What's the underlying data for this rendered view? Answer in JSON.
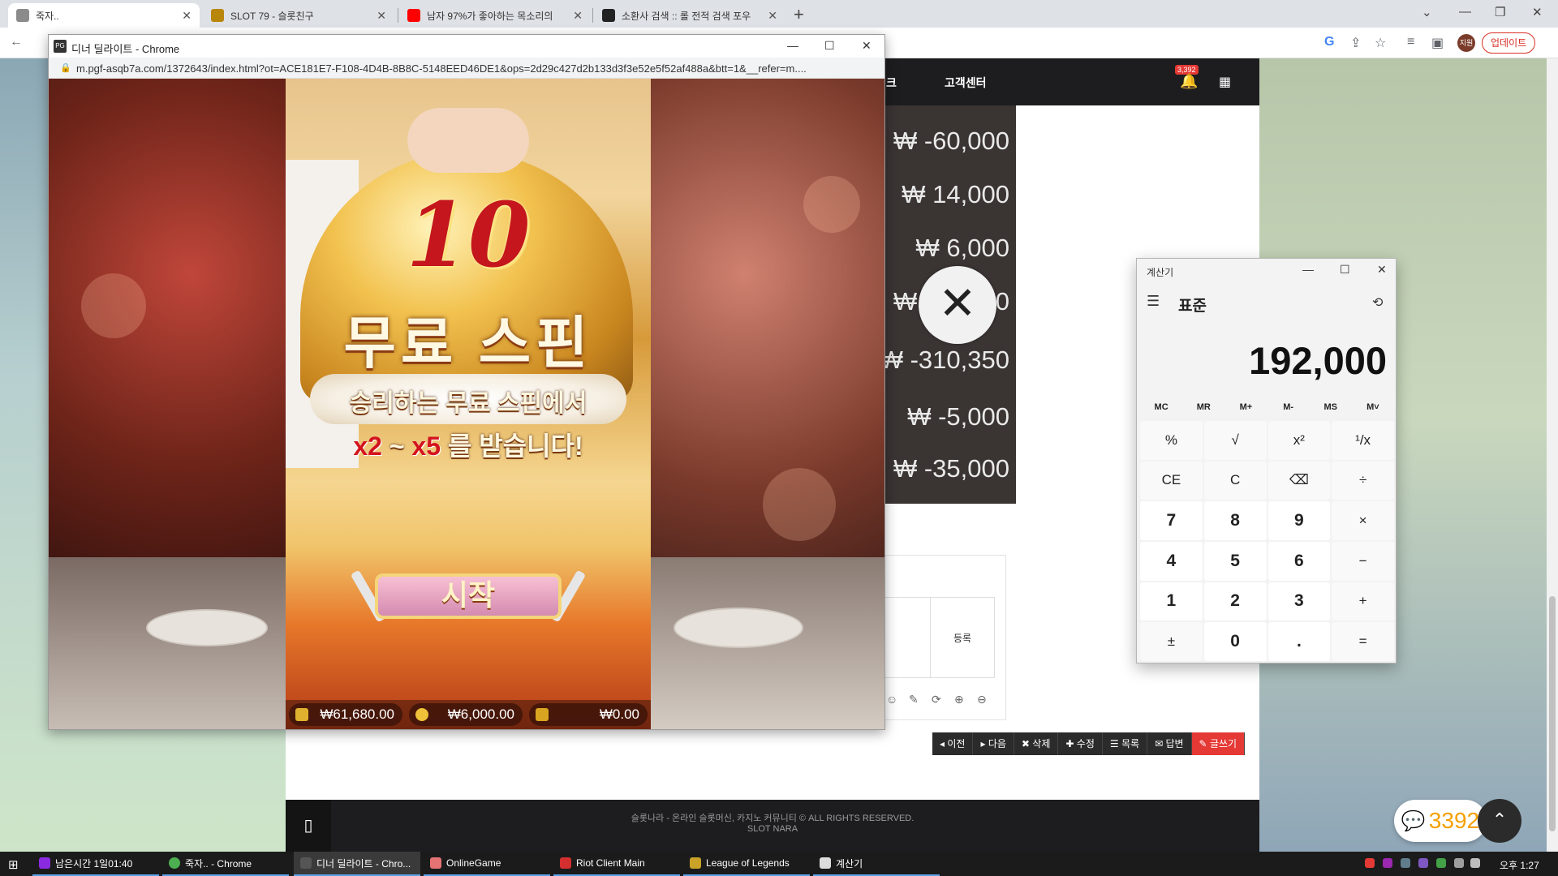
{
  "browser": {
    "tabs": [
      {
        "label": "죽자..",
        "color": "#8b8b8b"
      },
      {
        "label": "SLOT 79 - 슬롯친구",
        "color": "#b8860b"
      },
      {
        "label": "남자 97%가 좋아하는 목소리의",
        "color": "#ff0000"
      },
      {
        "label": "소환사 검색 :: 롤 전적 검색 포우",
        "color": "#222222"
      }
    ],
    "new_tab": "+",
    "profile_initials": "지원",
    "update_label": "업데이트"
  },
  "site": {
    "nav_fragment": "크",
    "nav_customer": "고객센터",
    "notification_count": "3,392",
    "amounts": [
      "₩ -60,000",
      "₩ 14,000",
      "₩ 6,000",
      "₩ -10,000",
      "₩ -310,350",
      "₩ -5,000",
      "₩ -35,000"
    ],
    "close_symbol": "✕",
    "register_label": "등록",
    "post_actions": [
      "이전",
      "다음",
      "삭제",
      "수정",
      "목록",
      "답변",
      "글쓰기"
    ],
    "footer_line1": "슬롯나라 - 온라인 슬롯머신, 카지노 커뮤니티 © ALL RIGHTS RESERVED.",
    "footer_line2": "SLOT NARA",
    "chat_count": "3392"
  },
  "popup": {
    "title": "디너 딜라이트 - Chrome",
    "url": "m.pgf-asqb7a.com/1372643/index.html?ot=ACE181E7-F108-4D4B-8B8C-5148EED46DE1&ops=2d29c427d2b133d3f3e52e5f52af488a&btt=1&__refer=m....",
    "game": {
      "free_count": "10",
      "free_title": "무료 스핀",
      "sub_line1": "승리하는 무료 스핀에서",
      "mult_low": "x2",
      "tilde": "~",
      "mult_high": "x5",
      "sub_line2_tail": "를 받습니다!",
      "start_label": "시작",
      "hud": {
        "balance": "₩61,680.00",
        "bet": "₩6,000.00",
        "win": "₩0.00"
      }
    }
  },
  "calculator": {
    "title": "계산기",
    "mode": "표준",
    "display": "192,000",
    "memory_keys": [
      "MC",
      "MR",
      "M+",
      "M-",
      "MS",
      "M˅"
    ],
    "keys": [
      "%",
      "√",
      "x²",
      "¹/x",
      "CE",
      "C",
      "⌫",
      "÷",
      "7",
      "8",
      "9",
      "×",
      "4",
      "5",
      "6",
      "−",
      "1",
      "2",
      "3",
      "+",
      "±",
      "0",
      ".",
      "="
    ]
  },
  "taskbar": {
    "items": [
      {
        "label": "남은시간 1일01:40",
        "color": "#8a2be2"
      },
      {
        "label": "죽자.. - Chrome",
        "color": "#4caf50"
      },
      {
        "label": "디너 딜라이트 - Chro...",
        "color": "#555555"
      },
      {
        "label": "OnlineGame",
        "color": "#e57373"
      },
      {
        "label": "Riot Client Main",
        "color": "#d32f2f"
      },
      {
        "label": "League of Legends",
        "color": "#c9a227"
      },
      {
        "label": "계산기",
        "color": "#dddddd"
      }
    ],
    "clock": "오후 1:27"
  }
}
